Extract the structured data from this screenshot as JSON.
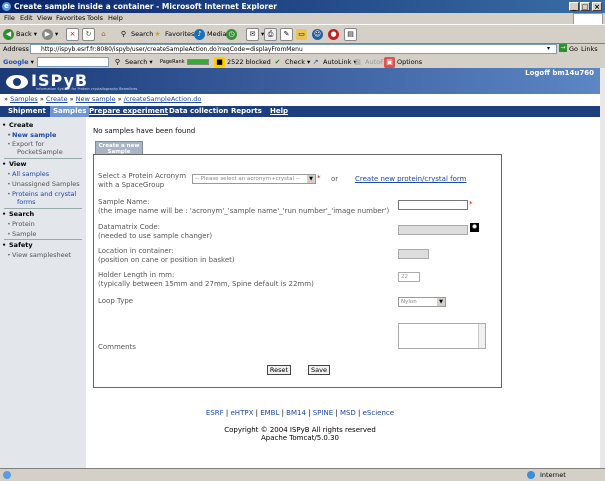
{
  "window": {
    "title": "Create sample inside a container - Microsoft Internet Explorer"
  },
  "menu": [
    "File",
    "Edit",
    "View",
    "Favorites",
    "Tools",
    "Help"
  ],
  "toolbar": {
    "back": "Back",
    "search": "Search",
    "favorites": "Favorites",
    "media": "Media"
  },
  "address": {
    "label": "Address",
    "url": "http://ispyb.esrf.fr:8080/ispyb/user/createSampleAction.do?reqCode=displayFromMenu",
    "go": "Go",
    "links": "Links"
  },
  "googlebar": {
    "label": "Google",
    "search": "Search",
    "pagerank": "PageRank",
    "blocked": "2522 blocked",
    "check": "Check",
    "autolink": "AutoLink",
    "autofill": "AutoFill",
    "options": "Options"
  },
  "app": {
    "logo": "ISPyB",
    "tagline": "Information System for Protein crystallography Beamlines",
    "logoff": "Logoff bm14u760"
  },
  "breadcrumb": {
    "samples": "Samples",
    "create": "Create",
    "new_sample": "New sample",
    "tail": "/createSampleAction.do"
  },
  "nav": {
    "shipment": "Shipment",
    "samples": "Samples",
    "prepare": "Prepare experiment",
    "data": "Data collection",
    "reports": "Reports",
    "help": "Help"
  },
  "sidebar": {
    "create": "Create",
    "new_sample": "New sample",
    "export1": "Export for",
    "export2": "PocketSample",
    "view": "View",
    "all_samples": "All samples",
    "unassigned": "Unassigned Samples",
    "proteins1": "Proteins and crystal",
    "proteins2": "forms",
    "search": "Search",
    "protein": "Protein",
    "sample": "Sample",
    "safety": "Safety",
    "samplesheet": "View samplesheet"
  },
  "main": {
    "message": "No samples have been found",
    "tab1": "Create a new",
    "tab2": "Sample"
  },
  "form": {
    "protein_label1": "Select a Protein Acronym",
    "protein_label2": "with a SpaceGroup",
    "protein_select": "-- Please select an acronym+crystal --",
    "or": "or",
    "create_link": "Create new protein/crystal form",
    "name_label1": "Sample Name:",
    "name_label2": "(the image name will be : 'acronym'_'sample name'_'run number'_'image number')",
    "dm_label1": "Datamatrix Code:",
    "dm_label2": "(needed to use sample changer)",
    "loc_label1": "Location in container:",
    "loc_label2": "(position on cane or position in basket)",
    "holder_label1": "Holder Length in mm:",
    "holder_label2": "(typically between 15mm and 27mm, Spine default is 22mm)",
    "holder_value": "22",
    "loop_label": "Loop Type",
    "loop_value": "Nylon",
    "comments_label": "Comments",
    "reset": "Reset",
    "save": "Save",
    "star": "*"
  },
  "footer": {
    "links": [
      "ESRF",
      "eHTPX",
      "EMBL",
      "BM14",
      "SPINE",
      "MSD",
      "eScience"
    ],
    "copyright": "Copyright © 2004 ISPyB All rights reserved",
    "server": "Apache Tomcat/5.0.30"
  },
  "status": {
    "zone": "Internet"
  }
}
